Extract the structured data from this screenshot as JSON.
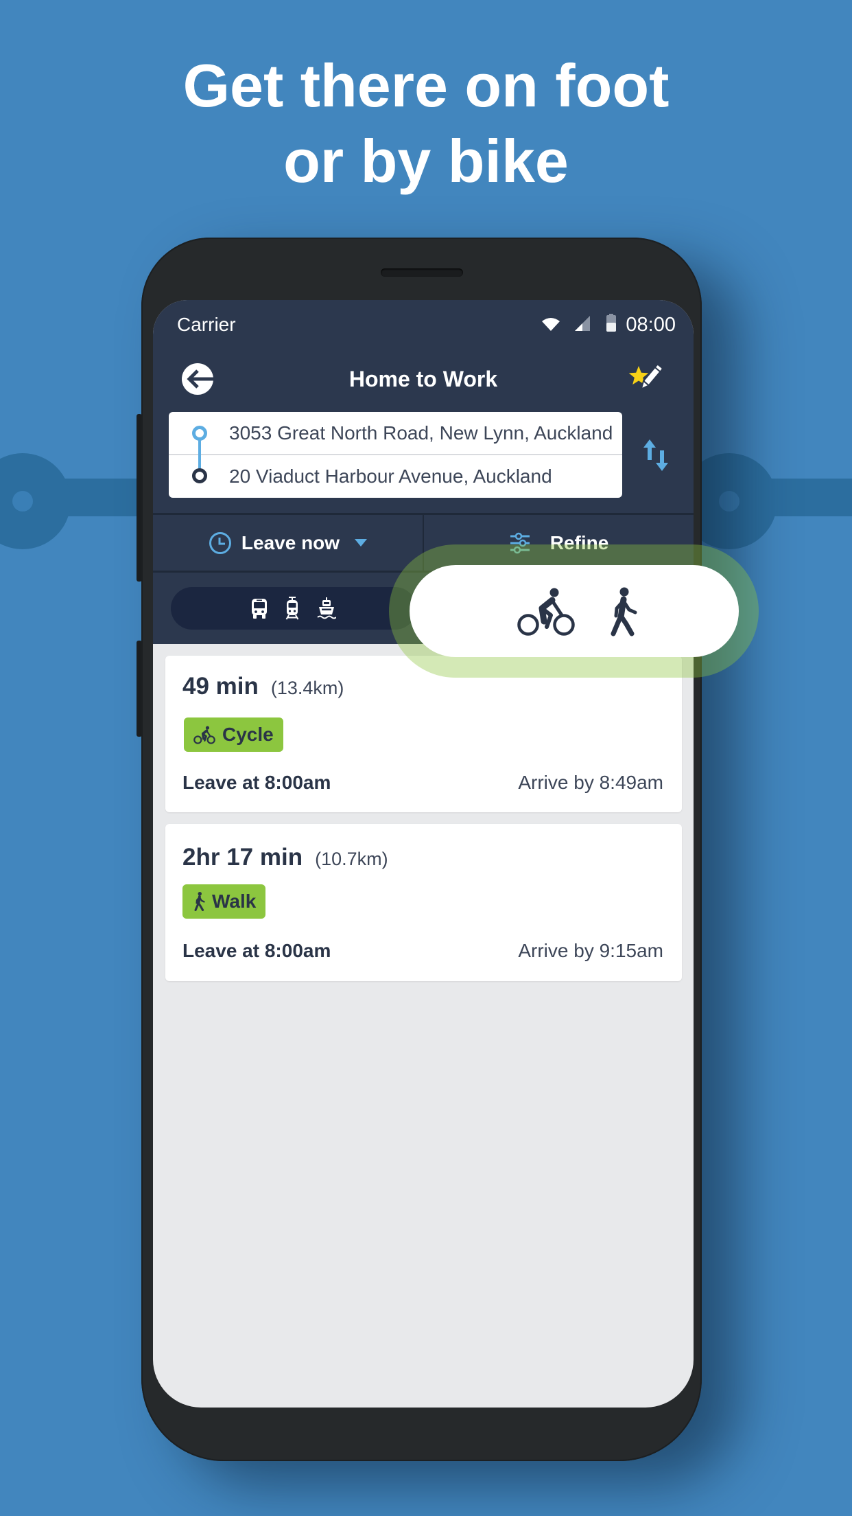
{
  "headline": {
    "line1": "Get there on foot",
    "line2": "or by bike"
  },
  "status_bar": {
    "carrier": "Carrier",
    "time": "08:00",
    "icons": [
      "wifi-icon",
      "cell-signal-icon",
      "battery-icon"
    ]
  },
  "header": {
    "title": "Home to Work",
    "back_icon": "back-arrow-icon",
    "favourite_icon": "star-pencil-icon"
  },
  "route": {
    "origin": "3053 Great North Road, New Lynn, Auckland",
    "destination": "20 Viaduct Harbour Avenue, Auckland",
    "swap_icon": "swap-arrows-icon"
  },
  "options": {
    "time_label": "Leave now",
    "time_icon": "clock-icon",
    "refine_label": "Refine",
    "refine_icon": "sliders-icon"
  },
  "modes": {
    "transit": [
      "bus-icon",
      "train-icon",
      "ferry-icon"
    ],
    "active": [
      "bicycle-icon",
      "walking-icon"
    ],
    "selected": "active"
  },
  "results": [
    {
      "duration": "49 min",
      "distance": "(13.4km)",
      "mode": "Cycle",
      "mode_icon": "bicycle-icon",
      "leave": "Leave at 8:00am",
      "arrive": "Arrive by 8:49am"
    },
    {
      "duration": "2hr 17 min",
      "distance": "(10.7km)",
      "mode": "Walk",
      "mode_icon": "walking-icon",
      "leave": "Leave at 8:00am",
      "arrive": "Arrive by 9:15am"
    }
  ],
  "colors": {
    "background": "#4286be",
    "app_header": "#2c384e",
    "accent_blue": "#5dade2",
    "mode_green": "#8cc63f",
    "text_dark": "#2a3447",
    "star_yellow": "#f7d117"
  }
}
